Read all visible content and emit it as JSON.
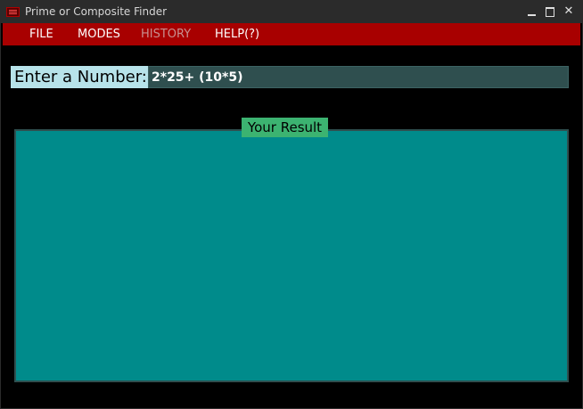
{
  "window": {
    "title": "Prime or Composite Finder",
    "icon": "app-icon"
  },
  "menu": {
    "file": "FILE",
    "modes": "MODES",
    "history": "HISTORY",
    "help": "HELP(?)"
  },
  "input": {
    "label": "Enter a Number:",
    "value": "2*25+ (10*5)"
  },
  "result": {
    "label": "Your Result",
    "text": ""
  },
  "colors": {
    "menubar": "#a80000",
    "label_bg": "#b7e3ea",
    "input_bg": "#2f4f4f",
    "badge_bg": "#3cb371",
    "panel_bg": "#008b8b"
  }
}
